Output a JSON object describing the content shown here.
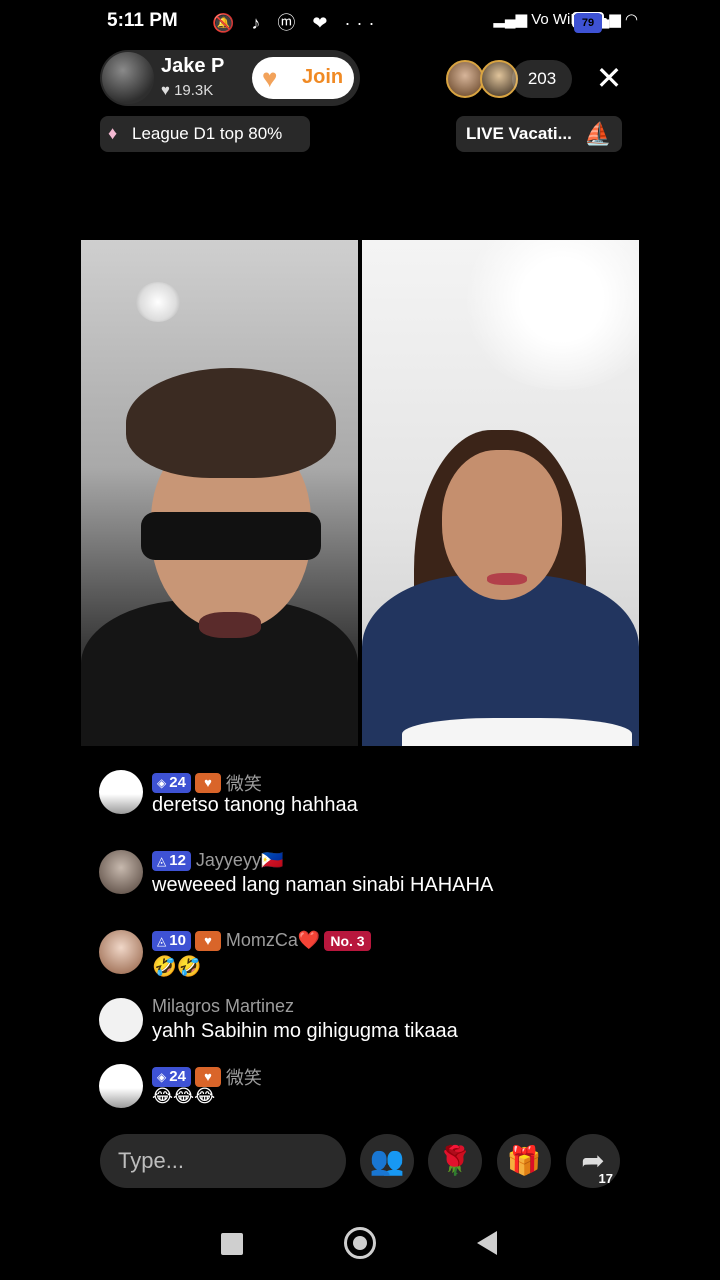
{
  "status_bar": {
    "time": "5:11 PM",
    "notif_icons": "🔕 ♪ ⓜ ❤ ···",
    "network": "Vo WiFi",
    "battery": "79"
  },
  "host": {
    "name": "Jake P",
    "likes": "19.3K",
    "heart": "♥",
    "join_icon": "♥",
    "join_label": "Join"
  },
  "viewers": {
    "count": "203",
    "close": "✕"
  },
  "league_tag": {
    "icon": "♦",
    "text": "League D1 top 80%"
  },
  "live_tag": {
    "text": "LIVE Vacati...",
    "icon": "⛵"
  },
  "comments": [
    {
      "level_symbol": "◈",
      "level": "24",
      "fan": "♥",
      "username": "微笑",
      "rank": "",
      "text": "deretso tanong hahhaa"
    },
    {
      "level_symbol": "◬",
      "level": "12",
      "fan": "",
      "username": "Jayyeyy🇵🇭",
      "rank": "",
      "text": "weweeed lang naman sinabi HAHAHA"
    },
    {
      "level_symbol": "◬",
      "level": "10",
      "fan": "♥",
      "username": "MomzCa❤️",
      "rank": "No. 3",
      "text": "🤣🤣"
    },
    {
      "level_symbol": "",
      "level": "",
      "fan": "",
      "username": "Milagros Martinez",
      "rank": "",
      "text": "yahh Sabihin mo gihigugma tikaaa"
    },
    {
      "level_symbol": "◈",
      "level": "24",
      "fan": "♥",
      "username": "微笑",
      "rank": "",
      "text": "😂😂😂"
    }
  ],
  "bottom_bar": {
    "type_placeholder": "Type...",
    "guests_icon": "👥",
    "rose_icon": "🌹",
    "gift_icon": "🎁",
    "share_icon": "➦",
    "share_count": "17"
  },
  "colors": {
    "background": "#000000",
    "join_text": "#f08a24",
    "level_badge": "#3e52d4",
    "rank_badge": "#b8173d"
  }
}
